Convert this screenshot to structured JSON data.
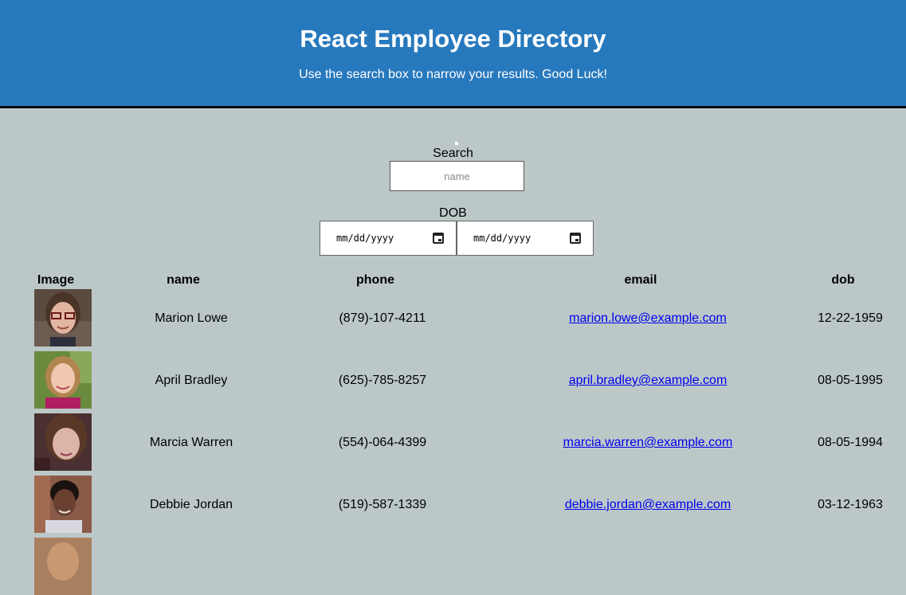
{
  "header": {
    "title": "React Employee Directory",
    "subtitle": "Use the search box to narrow your results. Good Luck!"
  },
  "search": {
    "label": "Search",
    "placeholder": "name",
    "value": ""
  },
  "dob_filter": {
    "label": "DOB",
    "start_placeholder": "mm/dd/yyyy",
    "end_placeholder": "mm/dd/yyyy"
  },
  "table": {
    "headers": [
      "Image",
      "name",
      "phone",
      "email",
      "dob"
    ],
    "rows": [
      {
        "name": "Marion Lowe",
        "phone": "(879)-107-4211",
        "email": "marion.lowe@example.com",
        "dob": "12-22-1959"
      },
      {
        "name": "April Bradley",
        "phone": "(625)-785-8257",
        "email": "april.bradley@example.com",
        "dob": "08-05-1995"
      },
      {
        "name": "Marcia Warren",
        "phone": "(554)-064-4399",
        "email": "marcia.warren@example.com",
        "dob": "08-05-1994"
      },
      {
        "name": "Debbie Jordan",
        "phone": "(519)-587-1339",
        "email": "debbie.jordan@example.com",
        "dob": "03-12-1963"
      }
    ]
  },
  "colors": {
    "header_bg": "#2779bd",
    "page_bg": "#bcc8c8",
    "link": "#0000ee"
  }
}
